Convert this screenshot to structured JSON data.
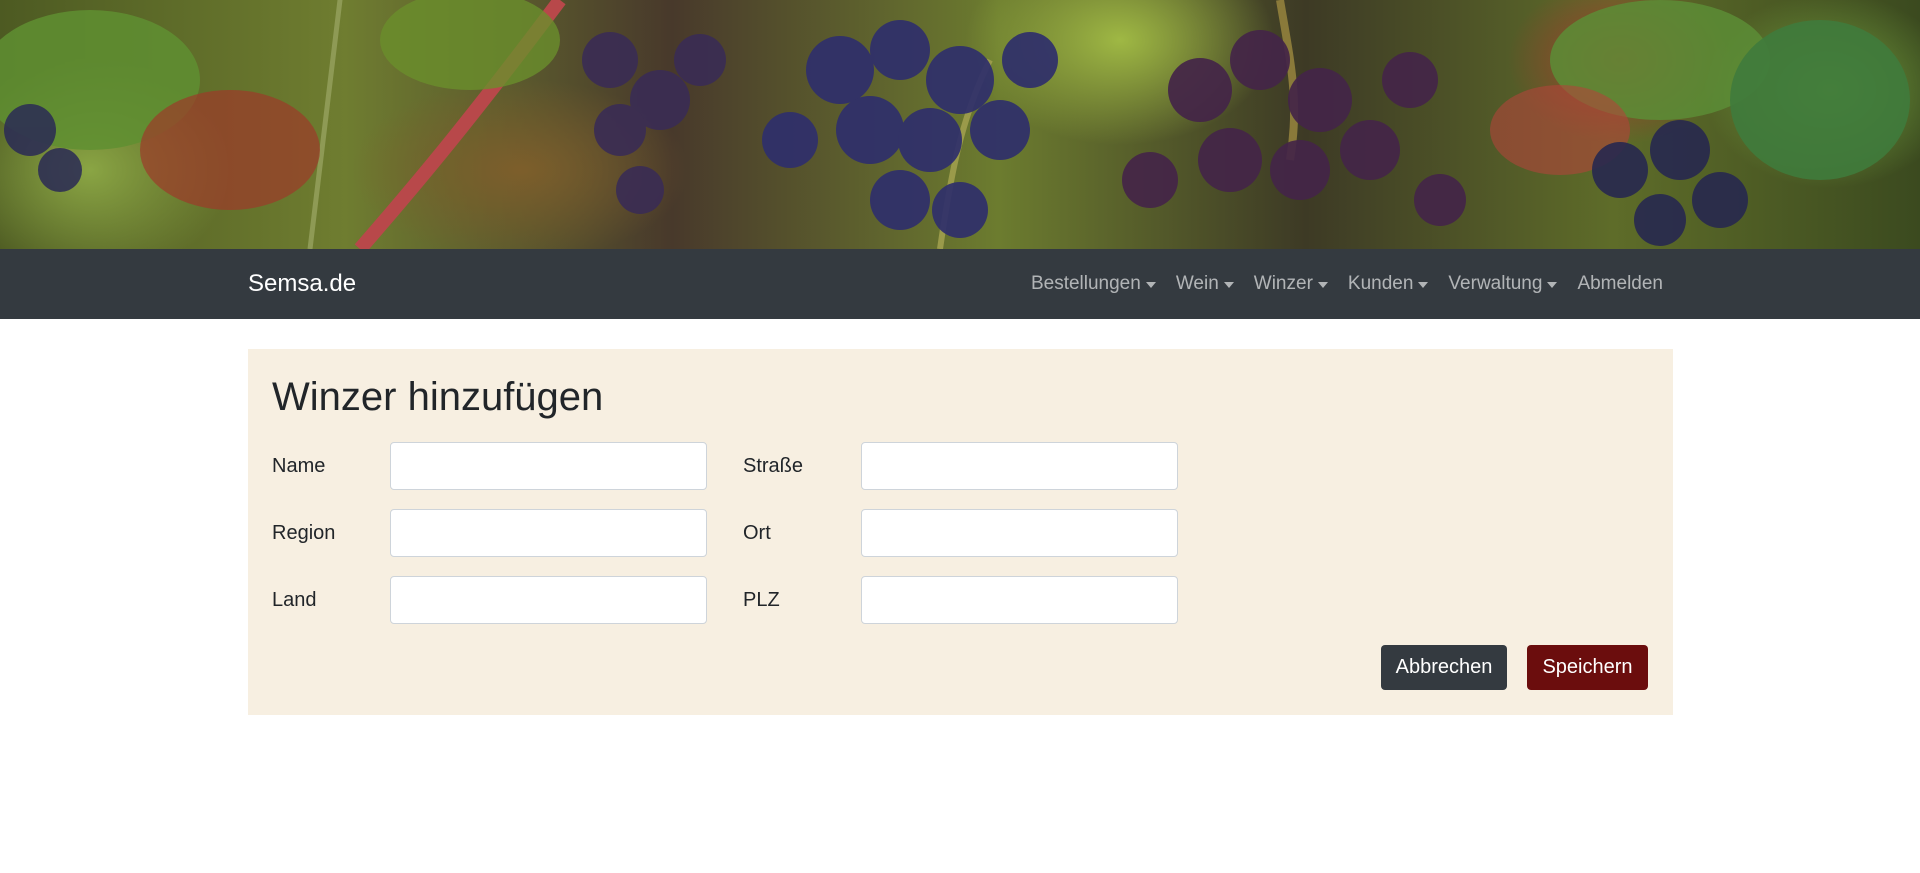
{
  "banner": {
    "alt": "vineyard-grapes"
  },
  "nav": {
    "brand": "Semsa.de",
    "items": [
      {
        "label": "Bestellungen",
        "dropdown": true
      },
      {
        "label": "Wein",
        "dropdown": true
      },
      {
        "label": "Winzer",
        "dropdown": true
      },
      {
        "label": "Kunden",
        "dropdown": true
      },
      {
        "label": "Verwaltung",
        "dropdown": true
      },
      {
        "label": "Abmelden",
        "dropdown": false
      }
    ]
  },
  "form": {
    "title": "Winzer hinzufügen",
    "fields": {
      "name": {
        "label": "Name",
        "value": ""
      },
      "region": {
        "label": "Region",
        "value": ""
      },
      "land": {
        "label": "Land",
        "value": ""
      },
      "strasse": {
        "label": "Straße",
        "value": ""
      },
      "ort": {
        "label": "Ort",
        "value": ""
      },
      "plz": {
        "label": "PLZ",
        "value": ""
      }
    },
    "cancel_label": "Abbrechen",
    "save_label": "Speichern"
  },
  "colors": {
    "navbar": "#343a40",
    "card": "#f7efe1",
    "save_button": "#6b0d0d",
    "cancel_button": "#343a40"
  }
}
